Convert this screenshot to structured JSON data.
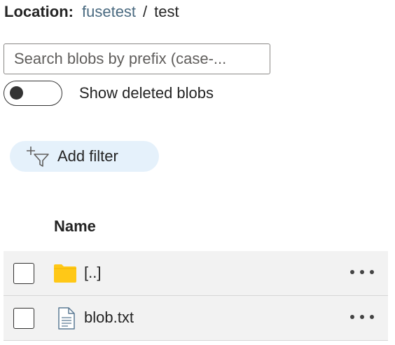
{
  "location": {
    "label": "Location:",
    "container": "fusetest",
    "separator": "/",
    "folder": "test"
  },
  "search": {
    "placeholder": "Search blobs by prefix (case-...",
    "value": ""
  },
  "toggle": {
    "label": "Show deleted blobs",
    "state": "off"
  },
  "filter": {
    "label": "Add filter",
    "icon": "add-filter-icon"
  },
  "table": {
    "columns": [
      "Name"
    ],
    "rows": [
      {
        "name": "[..]",
        "icon": "folder-icon",
        "icon_color": "#ffc817"
      },
      {
        "name": "blob.txt",
        "icon": "text-file-icon"
      }
    ]
  },
  "colors": {
    "link": "#4a6a80",
    "filter_bg": "#e5f1fb",
    "row_bg": "#f2f2f2"
  }
}
